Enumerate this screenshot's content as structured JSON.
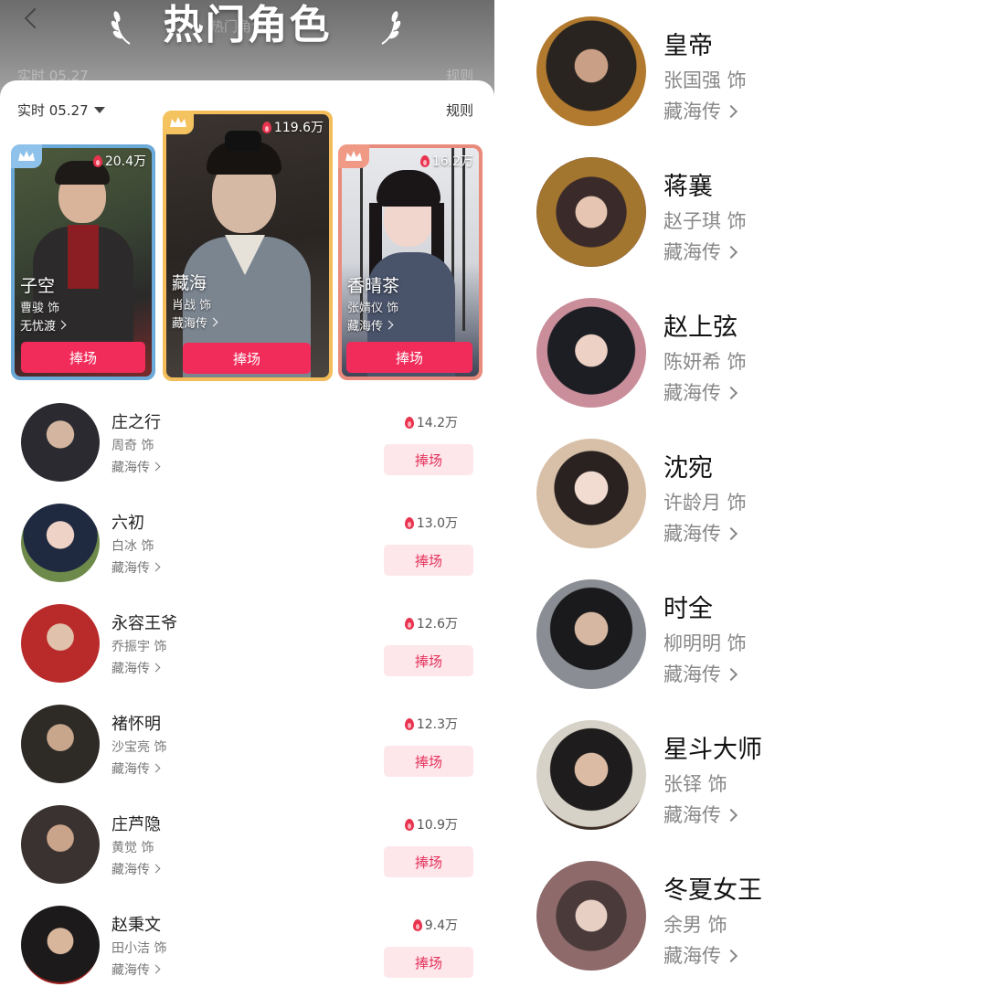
{
  "header": {
    "title": "热门角色",
    "ghost_title": "热门角色",
    "ghost_realtime": "实时 05.27",
    "ghost_rules": "规则"
  },
  "toolbar": {
    "realtime_label": "实时 05.27",
    "rules_label": "规则"
  },
  "top_cards": [
    {
      "rank": 2,
      "name": "子空",
      "actor": "曹骏 饰",
      "drama": "无忧渡",
      "heat": "20.4万",
      "button": "捧场",
      "frame_color": "#6aa9d8",
      "crown_color": "#8fc2ea"
    },
    {
      "rank": 1,
      "name": "藏海",
      "actor": "肖战 饰",
      "drama": "藏海传",
      "heat": "119.6万",
      "button": "捧场",
      "frame_color": "#f2bd5a",
      "crown_color": "#f4c25e"
    },
    {
      "rank": 3,
      "name": "香晴茶",
      "actor": "张婧仪 饰",
      "drama": "藏海传",
      "heat": "16.2万",
      "button": "捧场",
      "frame_color": "#e98b7c",
      "crown_color": "#f09a86"
    }
  ],
  "list": [
    {
      "name": "庄之行",
      "actor": "周奇 饰",
      "drama": "藏海传",
      "heat": "14.2万",
      "button": "捧场"
    },
    {
      "name": "六初",
      "actor": "白冰 饰",
      "drama": "藏海传",
      "heat": "13.0万",
      "button": "捧场"
    },
    {
      "name": "永容王爷",
      "actor": "乔振宇 饰",
      "drama": "藏海传",
      "heat": "12.6万",
      "button": "捧场"
    },
    {
      "name": "褚怀明",
      "actor": "沙宝亮 饰",
      "drama": "藏海传",
      "heat": "12.3万",
      "button": "捧场"
    },
    {
      "name": "庄芦隐",
      "actor": "黄觉 饰",
      "drama": "藏海传",
      "heat": "10.9万",
      "button": "捧场"
    },
    {
      "name": "赵秉文",
      "actor": "田小洁 饰",
      "drama": "藏海传",
      "heat": "9.4万",
      "button": "捧场"
    }
  ],
  "right_list": [
    {
      "name": "皇帝",
      "actor": "张国强 饰",
      "drama": "藏海传"
    },
    {
      "name": "蒋襄",
      "actor": "赵子琪 饰",
      "drama": "藏海传"
    },
    {
      "name": "赵上弦",
      "actor": "陈妍希 饰",
      "drama": "藏海传"
    },
    {
      "name": "沈宛",
      "actor": "许龄月 饰",
      "drama": "藏海传"
    },
    {
      "name": "时全",
      "actor": "柳明明 饰",
      "drama": "藏海传"
    },
    {
      "name": "星斗大师",
      "actor": "张铎 饰",
      "drama": "藏海传"
    },
    {
      "name": "冬夏女王",
      "actor": "余男 饰",
      "drama": "藏海传"
    }
  ],
  "colors": {
    "accent": "#f12c5a",
    "button_soft_bg": "#fde7eb",
    "button_soft_text": "#e5325b",
    "flame": "#e8344e"
  }
}
